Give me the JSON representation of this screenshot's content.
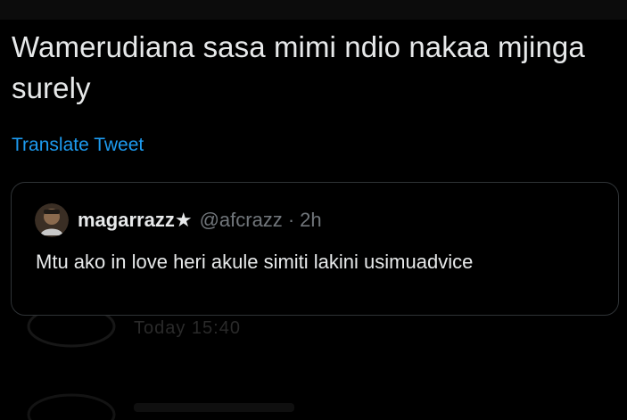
{
  "tweet": {
    "text": "Wamerudiana sasa mimi ndio nakaa mjinga surely",
    "translate_label": "Translate Tweet"
  },
  "quoted_tweet": {
    "display_name": "magarrazz★",
    "handle": "@afcrazz",
    "separator": "·",
    "time": "2h",
    "text": "Mtu ako in love heri akule simiti lakini usimuadvice"
  },
  "background_ghost": {
    "text_1": "Today 15:40"
  },
  "colors": {
    "background": "#000000",
    "primary_text": "#e7e9ea",
    "secondary_text": "#71767b",
    "link": "#1d9bf0",
    "border": "#2f3336"
  }
}
